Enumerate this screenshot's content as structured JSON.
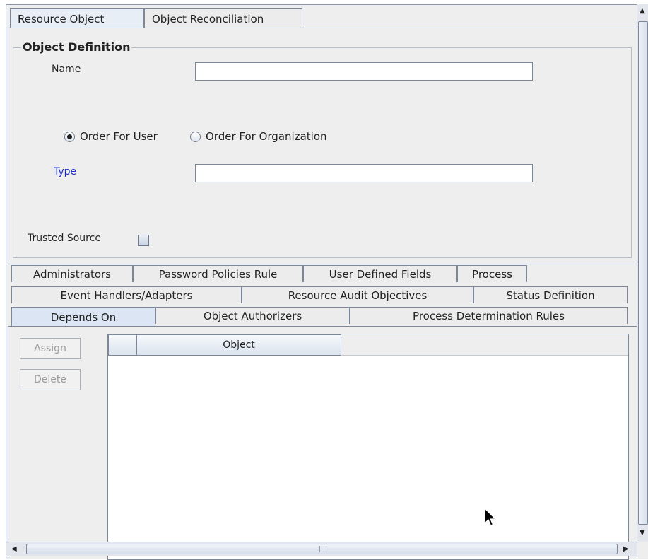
{
  "top_tabs": [
    {
      "label": "Resource Object",
      "active": true
    },
    {
      "label": "Object Reconciliation",
      "active": false
    }
  ],
  "object_definition": {
    "title": "Object Definition",
    "name_label": "Name",
    "name_value": "",
    "radio_user_label": "Order For User",
    "radio_org_label": "Order For Organization",
    "selected_radio": "user",
    "type_label": "Type",
    "type_value": "",
    "trusted_source_label": "Trusted Source",
    "trusted_source_checked": false
  },
  "lower_tabs": {
    "row1": [
      "Administrators",
      "Password Policies Rule",
      "User Defined Fields",
      "Process"
    ],
    "row2": [
      "Event Handlers/Adapters",
      "Resource Audit Objectives",
      "Status Definition"
    ],
    "row3": [
      "Depends On",
      "Object Authorizers",
      "Process Determination Rules"
    ],
    "active": "Depends On"
  },
  "buttons": {
    "assign": "Assign",
    "delete": "Delete"
  },
  "table": {
    "columns": [
      "",
      "Object"
    ],
    "rows": []
  },
  "scrollbar": {
    "h_thumb_grip": "|||",
    "arrow_up": "▲",
    "arrow_down": "▼",
    "arrow_left": "◀",
    "arrow_right": "▶"
  },
  "colors": {
    "type_label": "#1c2fd6",
    "active_tab": "#dbe5f3"
  }
}
